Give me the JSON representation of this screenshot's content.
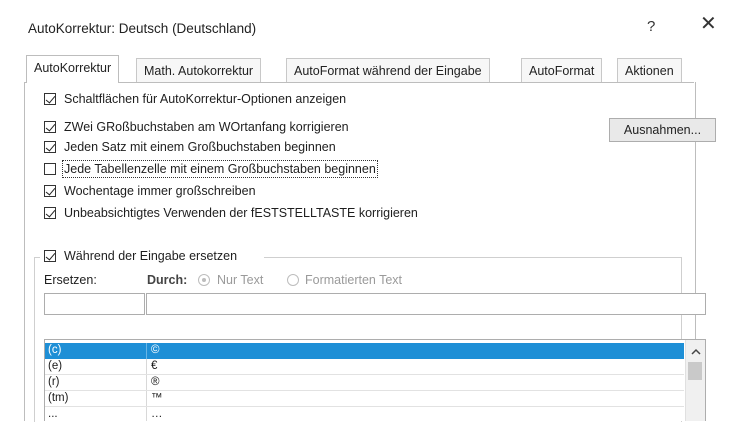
{
  "window": {
    "title": "AutoKorrektur: Deutsch (Deutschland)",
    "help_label": "?",
    "close_label": "✕"
  },
  "tabs": [
    {
      "label": "AutoKorrektur"
    },
    {
      "label": "Math. Autokorrektur"
    },
    {
      "label": "AutoFormat während der Eingabe"
    },
    {
      "label": "AutoFormat"
    },
    {
      "label": "Aktionen"
    }
  ],
  "options": [
    {
      "label": "Schaltflächen für AutoKorrektur-Optionen anzeigen",
      "checked": true
    },
    {
      "label": "ZWei GRoßbuchstaben am WOrtanfang korrigieren",
      "checked": true
    },
    {
      "label": "Jeden Satz mit einem Großbuchstaben beginnen",
      "checked": true
    },
    {
      "label": "Jede Tabellenzelle mit einem Großbuchstaben beginnen",
      "checked": false
    },
    {
      "label": "Wochentage immer großschreiben",
      "checked": true
    },
    {
      "label": "Unbeabsichtigtes Verwenden der fESTSTELLTASTE korrigieren",
      "checked": true
    }
  ],
  "exceptions_button": "Ausnahmen...",
  "replace_group": {
    "label": "Während der Eingabe ersetzen",
    "checked": true,
    "replace_label": "Ersetzen:",
    "with_label": "Durch:",
    "radio_plain": "Nur Text",
    "radio_formatted": "Formatierten Text",
    "replace_value": "",
    "with_value": ""
  },
  "entries": [
    {
      "from": "(c)",
      "to": "©",
      "selected": true
    },
    {
      "from": "(e)",
      "to": "€",
      "selected": false
    },
    {
      "from": "(r)",
      "to": "®",
      "selected": false
    },
    {
      "from": "(tm)",
      "to": "™",
      "selected": false
    },
    {
      "from": "...",
      "to": "…",
      "selected": false
    }
  ],
  "icons": {
    "scroll_up": "chevron-up-icon"
  },
  "colors": {
    "selection": "#1e8fd6",
    "border": "#adadad"
  }
}
